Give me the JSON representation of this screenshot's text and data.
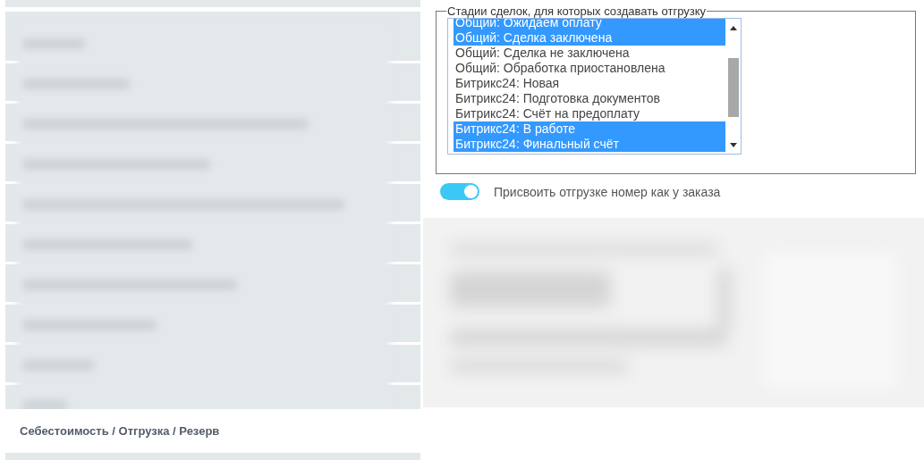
{
  "left_panel": {
    "footer_title": "Себестоимость / Отгрузка / Резерв"
  },
  "stages_field": {
    "legend": "Стадии сделок, для которых создавать отгрузку",
    "options": [
      {
        "label": "Общий: Ожидаем оплату",
        "selected": true
      },
      {
        "label": "Общий: Сделка заключена",
        "selected": true
      },
      {
        "label": "Общий: Сделка не заключена",
        "selected": false
      },
      {
        "label": "Общий: Обработка приостановлена",
        "selected": false
      },
      {
        "label": "Битрикс24: Новая",
        "selected": false
      },
      {
        "label": "Битрикс24: Подготовка документов",
        "selected": false
      },
      {
        "label": "Битрикс24: Счёт на предоплату",
        "selected": false
      },
      {
        "label": "Битрикс24: В работе",
        "selected": true
      },
      {
        "label": "Битрикс24: Финальный счёт",
        "selected": true
      }
    ]
  },
  "toggle": {
    "label": "Присвоить отгрузке номер как у заказа",
    "on": true
  }
}
